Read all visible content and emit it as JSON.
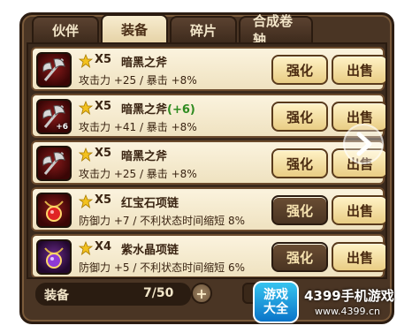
{
  "tabs": [
    {
      "label": "伙伴"
    },
    {
      "label": "装备"
    },
    {
      "label": "碎片"
    },
    {
      "label": "合成卷轴"
    }
  ],
  "active_tab": "装备",
  "items": [
    {
      "icon": "axe-icon",
      "count": "X5",
      "name": "暗黑之斧",
      "bonus": "",
      "plus_badge": "",
      "stats": "攻击力 +25 / 暴击 +8%",
      "upgrade_label": "强化",
      "sell_label": "出售",
      "upgrade_style": "light"
    },
    {
      "icon": "axe-icon",
      "count": "X5",
      "name": "暗黑之斧",
      "bonus": "(+6)",
      "plus_badge": "+6",
      "stats": "攻击力 +41 / 暴击 +8%",
      "upgrade_label": "强化",
      "sell_label": "出售",
      "upgrade_style": "light"
    },
    {
      "icon": "axe-icon",
      "count": "X5",
      "name": "暗黑之斧",
      "bonus": "",
      "plus_badge": "",
      "stats": "攻击力 +25 / 暴击 +8%",
      "upgrade_label": "强化",
      "sell_label": "出售",
      "upgrade_style": "light"
    },
    {
      "icon": "ruby-necklace-icon",
      "count": "X5",
      "name": "红宝石项链",
      "bonus": "",
      "plus_badge": "",
      "stats": "防御力 +7 / 不利状态时间缩短 8%",
      "upgrade_label": "强化",
      "sell_label": "出售",
      "upgrade_style": "dark"
    },
    {
      "icon": "amethyst-necklace-icon",
      "count": "X4",
      "name": "紫水晶项链",
      "bonus": "",
      "plus_badge": "",
      "stats": "防御力 +5 / 不利状态时间缩短 6%",
      "upgrade_label": "强化",
      "sell_label": "出售",
      "upgrade_style": "dark"
    }
  ],
  "footer": {
    "label": "装备",
    "capacity": "7/50"
  },
  "watermark": {
    "logo_line1": "游戏",
    "logo_line2": "大全",
    "site": "4399手机游戏",
    "url": "www.4399.cn"
  },
  "colors": {
    "frame_bg": "#4a3524",
    "row_bg": "#fbf3de",
    "bonus_green": "#2e8b1f",
    "button_light": "#e9cd84",
    "button_dark": "#4a3422"
  }
}
